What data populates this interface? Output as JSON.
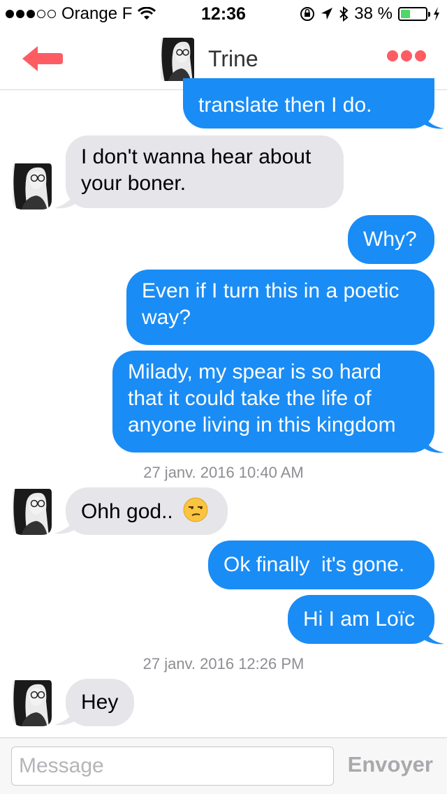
{
  "status_bar": {
    "carrier": "Orange F",
    "time": "12:36",
    "battery_percent": "38 %",
    "battery_level": 0.38,
    "signal_bars_filled": 3,
    "signal_bars_total": 5
  },
  "header": {
    "contact_name": "Trine",
    "accent_color": "#fd5c63"
  },
  "messages": [
    {
      "from": "me",
      "text": "translate then I do."
    },
    {
      "from": "them",
      "text": "I don't wanna hear about your boner."
    },
    {
      "from": "me",
      "text": "Why?"
    },
    {
      "from": "me",
      "text": "Even if I turn this in a poetic way?"
    },
    {
      "from": "me",
      "text": "Milady, my spear is so hard that it could take the life of anyone living in this kingdom"
    },
    {
      "timestamp": "27 janv. 2016 10:40 AM"
    },
    {
      "from": "them",
      "text": "Ohh god..",
      "emoji": "unamused-face"
    },
    {
      "from": "me",
      "text": "Ok finally  it's gone."
    },
    {
      "from": "me",
      "text": "Hi I am Loïc"
    },
    {
      "timestamp": "27 janv. 2016 12:26 PM"
    },
    {
      "from": "them",
      "text": "Hey"
    }
  ],
  "composer": {
    "placeholder": "Message",
    "value": "",
    "send_label": "Envoyer"
  },
  "colors": {
    "outgoing_bubble": "#1a8cf5",
    "incoming_bubble": "#e5e5ea",
    "battery_fill": "#4cd964"
  }
}
